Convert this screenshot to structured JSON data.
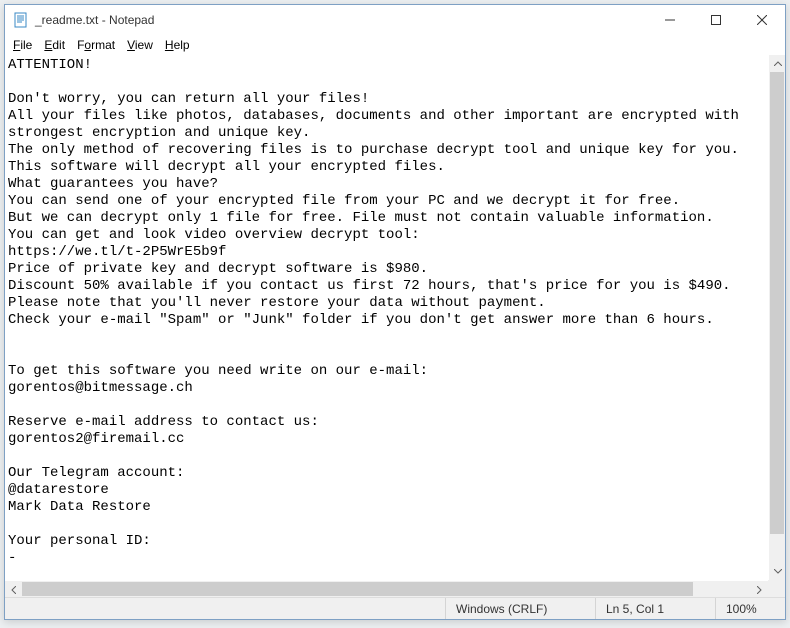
{
  "titlebar": {
    "title": "_readme.txt - Notepad"
  },
  "menu": {
    "file": "File",
    "edit": "Edit",
    "format": "Format",
    "view": "View",
    "help": "Help"
  },
  "document": {
    "text": "ATTENTION!\n\nDon't worry, you can return all your files!\nAll your files like photos, databases, documents and other important are encrypted with strongest encryption and unique key.\nThe only method of recovering files is to purchase decrypt tool and unique key for you.\nThis software will decrypt all your encrypted files.\nWhat guarantees you have?\nYou can send one of your encrypted file from your PC and we decrypt it for free.\nBut we can decrypt only 1 file for free. File must not contain valuable information.\nYou can get and look video overview decrypt tool:\nhttps://we.tl/t-2P5WrE5b9f\nPrice of private key and decrypt software is $980.\nDiscount 50% available if you contact us first 72 hours, that's price for you is $490.\nPlease note that you'll never restore your data without payment.\nCheck your e-mail \"Spam\" or \"Junk\" folder if you don't get answer more than 6 hours.\n\n\nTo get this software you need write on our e-mail:\ngorentos@bitmessage.ch\n\nReserve e-mail address to contact us:\ngorentos2@firemail.cc\n\nOur Telegram account:\n@datarestore\nMark Data Restore\n\nYour personal ID:\n-"
  },
  "statusbar": {
    "encoding": "Windows (CRLF)",
    "position": "Ln 5, Col 1",
    "zoom": "100%"
  },
  "icons": {
    "minimize": "minimize-icon",
    "maximize": "maximize-icon",
    "close": "close-icon",
    "notepad": "notepad-icon"
  }
}
